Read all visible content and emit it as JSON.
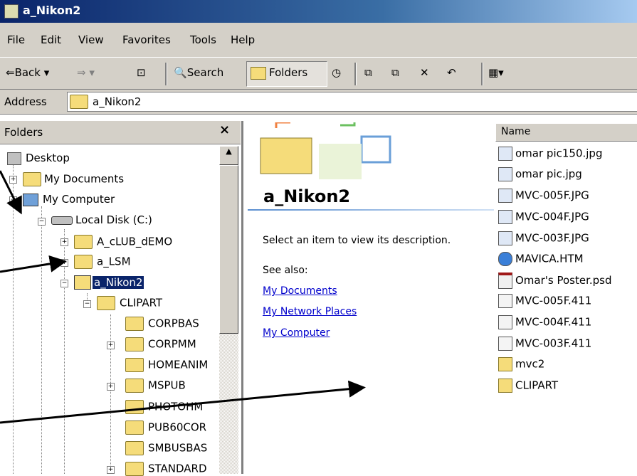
{
  "window": {
    "title": "a_Nikon2"
  },
  "menu": [
    "File",
    "Edit",
    "View",
    "Favorites",
    "Tools",
    "Help"
  ],
  "toolbar": {
    "back": "Back",
    "search": "Search",
    "folders": "Folders"
  },
  "address": {
    "label": "Address",
    "value": "a_Nikon2"
  },
  "folders_pane": {
    "title": "Folders",
    "close": "×",
    "tree": [
      "Desktop",
      "My Documents",
      "My Computer",
      "Local Disk (C:)",
      "A_cLUB_dEMO",
      "a_LSM",
      "a_Nikon2",
      "CLIPART",
      "CORPBAS",
      "CORPMM",
      "HOMEANIM",
      "MSPUB",
      "PHOTOHM",
      "PUB60COR",
      "SMBUSBAS",
      "STANDARD"
    ]
  },
  "details": {
    "title": "a_Nikon2",
    "description": "Select an item to view its description.",
    "see_also": "See also:",
    "links": [
      "My Documents",
      "My Network Places",
      "My Computer"
    ]
  },
  "files": {
    "column": "Name",
    "items": [
      "omar pic150.jpg",
      "omar pic.jpg",
      "MVC-005F.JPG",
      "MVC-004F.JPG",
      "MVC-003F.JPG",
      "MAVICA.HTM",
      "Omar's Poster.psd",
      "MVC-005F.411",
      "MVC-004F.411",
      "MVC-003F.411",
      "mvc2",
      "CLIPART"
    ]
  }
}
